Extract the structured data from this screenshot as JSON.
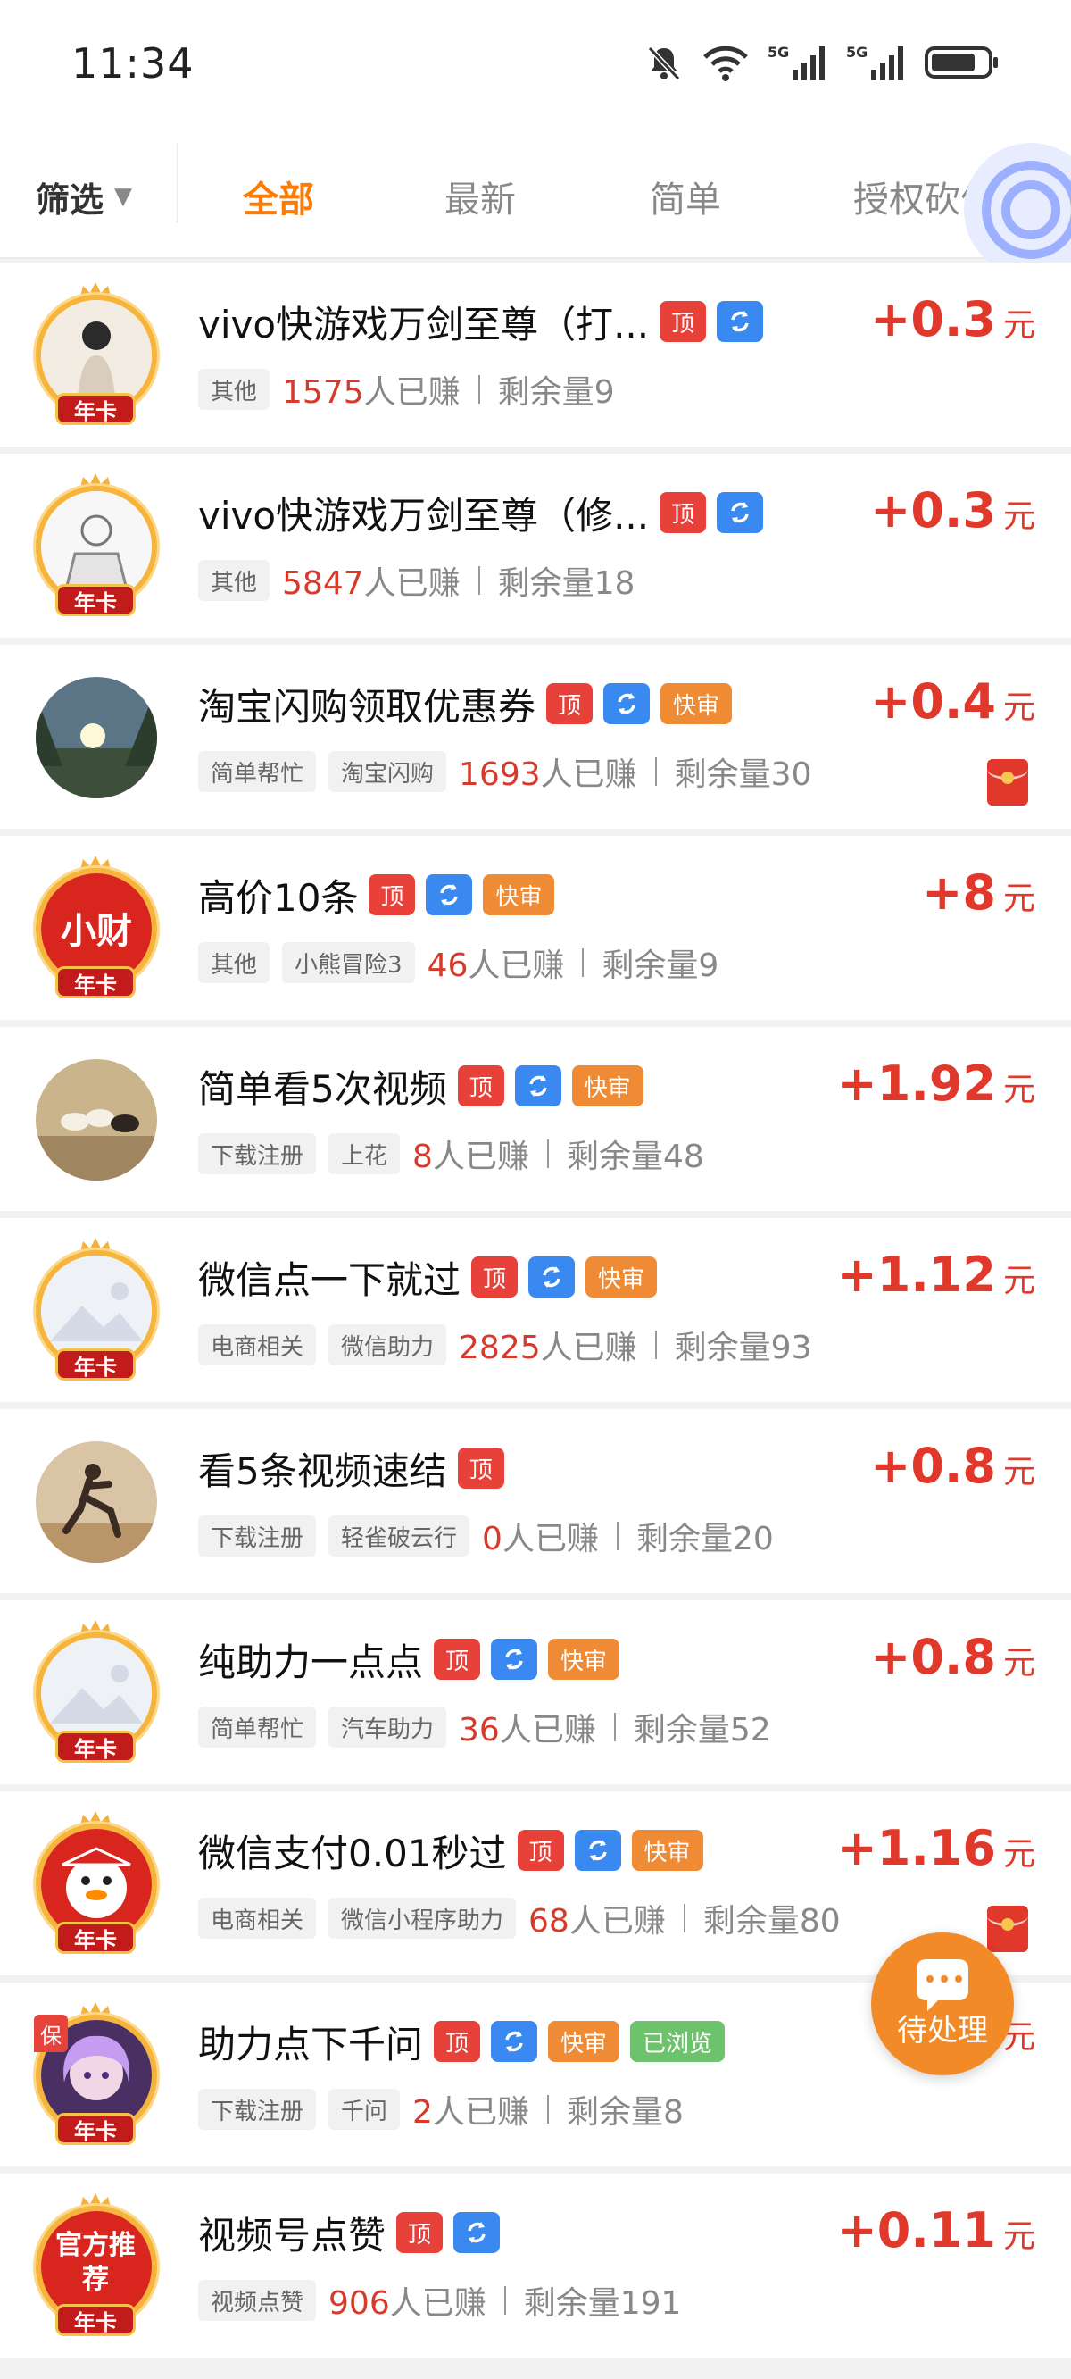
{
  "status_bar": {
    "time": "11:34",
    "icons": [
      "mute-icon",
      "wifi-icon",
      "signal-5g-icon",
      "signal-5g-icon",
      "battery-icon"
    ]
  },
  "filter": {
    "label": "筛选",
    "arrow": "▼"
  },
  "tabs": [
    {
      "label": "全部",
      "active": true
    },
    {
      "label": "最新",
      "active": false
    },
    {
      "label": "简单",
      "active": false
    },
    {
      "label": "授权砍价",
      "active": false
    }
  ],
  "colors": {
    "accent": "#ff7a00",
    "reward": "#e0382b",
    "earn_number": "#d53a2b"
  },
  "tasks": [
    {
      "title": "vivo快游戏万剑至尊（打...",
      "badges": {
        "top": "顶",
        "refresh": true,
        "fast": "",
        "viewed": ""
      },
      "tags": [
        "其他"
      ],
      "earn_count": "1575",
      "earn_suffix": "人已赚",
      "remaining": "剩余量9",
      "reward": "+0.3",
      "unit": "元",
      "avatar": {
        "style": "person",
        "year_card": "年卡",
        "guarantee": ""
      },
      "red_envelope": false
    },
    {
      "title": "vivo快游戏万剑至尊（修...",
      "badges": {
        "top": "顶",
        "refresh": true,
        "fast": "",
        "viewed": ""
      },
      "tags": [
        "其他"
      ],
      "earn_count": "5847",
      "earn_suffix": "人已赚",
      "remaining": "剩余量18",
      "reward": "+0.3",
      "unit": "元",
      "avatar": {
        "style": "sketch",
        "year_card": "年卡",
        "guarantee": ""
      },
      "red_envelope": false
    },
    {
      "title": "淘宝闪购领取优惠券",
      "badges": {
        "top": "顶",
        "refresh": true,
        "fast": "快审",
        "viewed": ""
      },
      "tags": [
        "简单帮忙",
        "淘宝闪购"
      ],
      "earn_count": "1693",
      "earn_suffix": "人已赚",
      "remaining": "剩余量30",
      "reward": "+0.4",
      "unit": "元",
      "avatar": {
        "style": "forest",
        "year_card": "",
        "guarantee": ""
      },
      "red_envelope": true
    },
    {
      "title": "高价10条",
      "badges": {
        "top": "顶",
        "refresh": true,
        "fast": "快审",
        "viewed": ""
      },
      "tags": [
        "其他",
        "小熊冒险3"
      ],
      "earn_count": "46",
      "earn_suffix": "人已赚",
      "remaining": "剩余量9",
      "reward": "+8",
      "unit": "元",
      "avatar": {
        "style": "red-logo",
        "year_card": "年卡",
        "guarantee": ""
      },
      "red_envelope": false
    },
    {
      "title": "简单看5次视频",
      "badges": {
        "top": "顶",
        "refresh": true,
        "fast": "快审",
        "viewed": ""
      },
      "tags": [
        "下载注册",
        "上花"
      ],
      "earn_count": "8",
      "earn_suffix": "人已赚",
      "remaining": "剩余量48",
      "reward": "+1.92",
      "unit": "元",
      "avatar": {
        "style": "horses",
        "year_card": "",
        "guarantee": ""
      },
      "red_envelope": false
    },
    {
      "title": "微信点一下就过",
      "badges": {
        "top": "顶",
        "refresh": true,
        "fast": "快审",
        "viewed": ""
      },
      "tags": [
        "电商相关",
        "微信助力"
      ],
      "earn_count": "2825",
      "earn_suffix": "人已赚",
      "remaining": "剩余量93",
      "reward": "+1.12",
      "unit": "元",
      "avatar": {
        "style": "placeholder",
        "year_card": "年卡",
        "guarantee": ""
      },
      "red_envelope": false
    },
    {
      "title": "看5条视频速结",
      "badges": {
        "top": "顶",
        "refresh": false,
        "fast": "",
        "viewed": ""
      },
      "tags": [
        "下载注册",
        "轻雀破云行"
      ],
      "earn_count": "0",
      "earn_suffix": "人已赚",
      "remaining": "剩余量20",
      "reward": "+0.8",
      "unit": "元",
      "avatar": {
        "style": "runner",
        "year_card": "",
        "guarantee": ""
      },
      "red_envelope": false
    },
    {
      "title": "纯助力一点点",
      "badges": {
        "top": "顶",
        "refresh": true,
        "fast": "快审",
        "viewed": ""
      },
      "tags": [
        "简单帮忙",
        "汽车助力"
      ],
      "earn_count": "36",
      "earn_suffix": "人已赚",
      "remaining": "剩余量52",
      "reward": "+0.8",
      "unit": "元",
      "avatar": {
        "style": "placeholder",
        "year_card": "年卡",
        "guarantee": ""
      },
      "red_envelope": false
    },
    {
      "title": "微信支付0.01秒过",
      "badges": {
        "top": "顶",
        "refresh": true,
        "fast": "快审",
        "viewed": ""
      },
      "tags": [
        "电商相关",
        "微信小程序助力"
      ],
      "earn_count": "68",
      "earn_suffix": "人已赚",
      "remaining": "剩余量80",
      "reward": "+1.16",
      "unit": "元",
      "avatar": {
        "style": "snowman",
        "year_card": "年卡",
        "guarantee": ""
      },
      "red_envelope": true
    },
    {
      "title": "助力点下千问",
      "badges": {
        "top": "顶",
        "refresh": true,
        "fast": "快审",
        "viewed": "已浏览"
      },
      "tags": [
        "下载注册",
        "千问"
      ],
      "earn_count": "2",
      "earn_suffix": "人已赚",
      "remaining": "剩余量8",
      "reward": "",
      "unit": "元",
      "avatar": {
        "style": "anime",
        "year_card": "年卡",
        "guarantee": "保"
      },
      "red_envelope": false
    },
    {
      "title": "视频号点赞",
      "badges": {
        "top": "顶",
        "refresh": true,
        "fast": "",
        "viewed": ""
      },
      "tags": [
        "视频点赞"
      ],
      "earn_count": "906",
      "earn_suffix": "人已赚",
      "remaining": "剩余量191",
      "reward": "+0.11",
      "unit": "元",
      "avatar": {
        "style": "official",
        "year_card": "年卡",
        "guarantee": "",
        "text": "官方推荐"
      },
      "red_envelope": false
    }
  ],
  "pending_button": {
    "label": "待处理",
    "icon": "chat-bubble-icon"
  }
}
